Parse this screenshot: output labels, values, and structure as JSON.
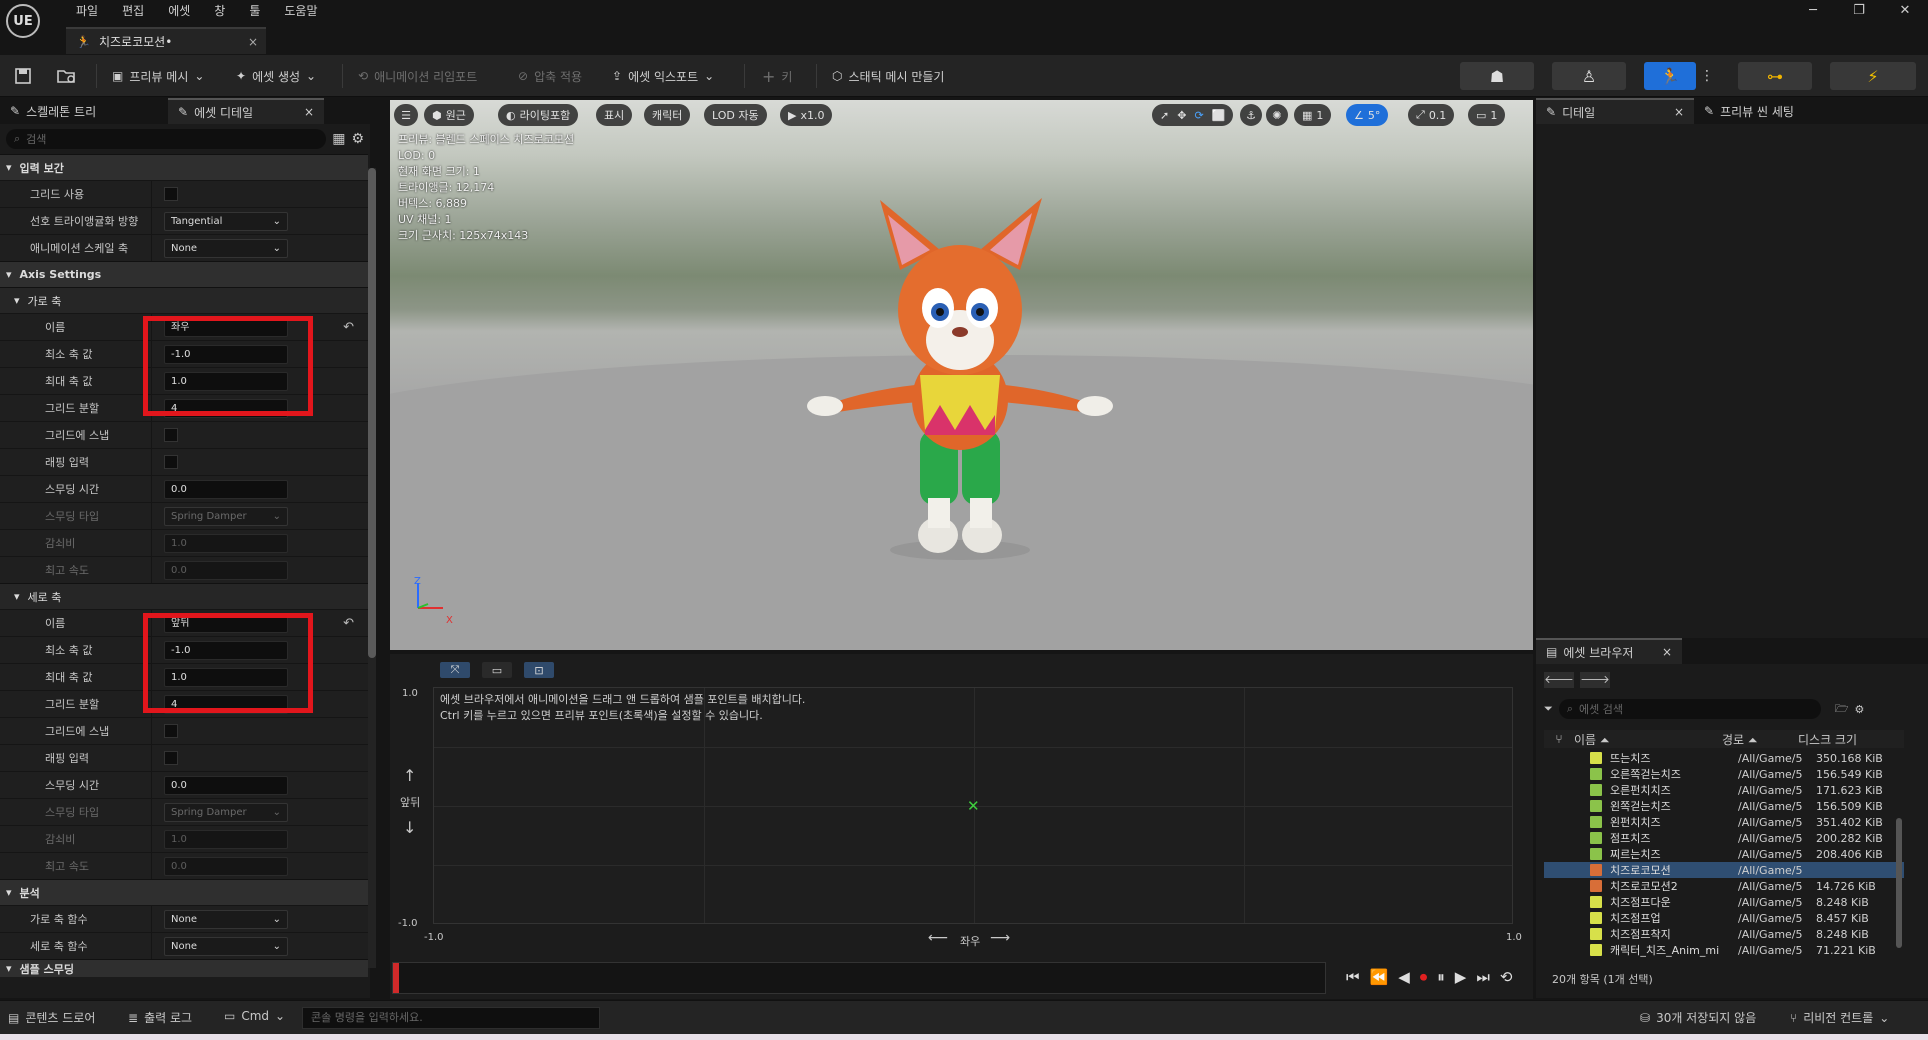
{
  "app": {
    "logo": "UE"
  },
  "menu": [
    "파일",
    "편집",
    "에셋",
    "창",
    "툴",
    "도움말"
  ],
  "doc_tab": {
    "title": "치즈로코모션•",
    "close": "×"
  },
  "window_controls": {
    "minimize": "─",
    "restore": "❐",
    "close": "✕"
  },
  "toolbar": {
    "preview_mesh": "프리뷰 메시",
    "asset_create": "에셋 생성",
    "anim_reimport": "애니메이션 리임포트",
    "apply_compression": "압축 적용",
    "asset_export": "에셋 익스포트",
    "key": "키",
    "make_static_mesh": "스태틱 메시 만들기"
  },
  "left_tabs": {
    "skeleton_tree": "스켈레톤 트리",
    "asset_details": "에셋 디테일",
    "close": "×"
  },
  "search": {
    "placeholder": "검색"
  },
  "sections": {
    "input_interp": "입력 보간",
    "axis_settings": "Axis Settings",
    "horizontal": "가로 축",
    "vertical": "세로 축",
    "analysis": "분석",
    "sample_smoothing": "샘플 스무딩"
  },
  "input_interp": {
    "use_grid": "그리드 사용",
    "pref_tri_dir": "선호 트라이앵귤화 방향",
    "pref_tri_dir_val": "Tangential",
    "anim_scale_axis": "애니메이션 스케일 축",
    "anim_scale_axis_val": "None"
  },
  "horizontal_axis": {
    "name_lbl": "이름",
    "name_val": "좌우",
    "min_lbl": "최소 축 값",
    "min_val": "-1.0",
    "max_lbl": "최대 축 값",
    "max_val": "1.0",
    "grid_div_lbl": "그리드 분할",
    "grid_div_val": "4",
    "snap_lbl": "그리드에 스냅",
    "wrap_lbl": "래핑 입력",
    "smooth_time_lbl": "스무딩 시간",
    "smooth_time_val": "0.0",
    "smooth_type_lbl": "스무딩 타입",
    "smooth_type_val": "Spring Damper",
    "damping_lbl": "감쇠비",
    "damping_val": "1.0",
    "max_speed_lbl": "최고 속도",
    "max_speed_val": "0.0"
  },
  "vertical_axis": {
    "name_lbl": "이름",
    "name_val": "앞뒤",
    "min_lbl": "최소 축 값",
    "min_val": "-1.0",
    "max_lbl": "최대 축 값",
    "max_val": "1.0",
    "grid_div_lbl": "그리드 분할",
    "grid_div_val": "4",
    "snap_lbl": "그리드에 스냅",
    "wrap_lbl": "래핑 입력",
    "smooth_time_lbl": "스무딩 시간",
    "smooth_time_val": "0.0",
    "smooth_type_lbl": "스무딩 타입",
    "smooth_type_val": "Spring Damper",
    "damping_lbl": "감쇠비",
    "damping_val": "1.0",
    "max_speed_lbl": "최고 속도",
    "max_speed_val": "0.0"
  },
  "analysis": {
    "h_func_lbl": "가로 축 함수",
    "h_func_val": "None",
    "v_func_lbl": "세로 축 함수",
    "v_func_val": "None"
  },
  "viewport": {
    "perspective": "원근",
    "lighting": "라이팅포함",
    "show": "표시",
    "character": "캐릭터",
    "lod": "LOD 자동",
    "speed": "x1.0",
    "grid_val": "1",
    "angle_val": "5°",
    "scale_val": "0.1",
    "cam_val": "1",
    "info": [
      "프리뷰: 블렌드 스페이스 치즈로코모션",
      "LOD: 0",
      "현재 화면 크기: 1",
      "트라이앵글: 12,174",
      "버텍스: 6,889",
      "UV 채널: 1",
      "크기 근사치: 125x74x143"
    ],
    "axis_z": "Z",
    "axis_x": "X"
  },
  "blendspace": {
    "hint1": "에셋 브라우저에서 애니메이션을 드래그 앤 드롭하여 샘플 포인트를 배치합니다.",
    "hint2": "Ctrl 키를 누르고 있으면 프리뷰 포인트(초록색)을 설정할 수 있습니다.",
    "y_max": "1.0",
    "y_min": "-1.0",
    "x_min": "-1.0",
    "x_max": "1.0",
    "y_axis": "앞뒤",
    "x_axis": "좌우"
  },
  "right_tabs": {
    "details": "디테일",
    "preview_scene": "프리뷰 씬 세팅",
    "close": "×"
  },
  "asset_browser": {
    "title": "에셋 브라우저",
    "close": "×",
    "search_placeholder": "에셋 검색",
    "col_name": "이름",
    "col_path": "경로",
    "col_size": "디스크 크기",
    "status": "20개 항목 (1개 선택)",
    "rows": [
      {
        "name": "뜨는치즈",
        "path": "/All/Game/5",
        "size": "350.168 KiB",
        "kind": "y"
      },
      {
        "name": "오른쪽걷는치즈",
        "path": "/All/Game/5",
        "size": "156.549 KiB",
        "kind": "g"
      },
      {
        "name": "오른펀치치즈",
        "path": "/All/Game/5",
        "size": "171.623 KiB",
        "kind": "g"
      },
      {
        "name": "왼쪽걷는치즈",
        "path": "/All/Game/5",
        "size": "156.509 KiB",
        "kind": "g"
      },
      {
        "name": "왼펀치치즈",
        "path": "/All/Game/5",
        "size": "351.402 KiB",
        "kind": "g"
      },
      {
        "name": "점프치즈",
        "path": "/All/Game/5",
        "size": "200.282 KiB",
        "kind": "g"
      },
      {
        "name": "찌르는치즈",
        "path": "/All/Game/5",
        "size": "208.406 KiB",
        "kind": "g"
      },
      {
        "name": "치즈로코모션",
        "path": "/All/Game/5",
        "size": "",
        "kind": "sel"
      },
      {
        "name": "치즈로코모션2",
        "path": "/All/Game/5",
        "size": "14.726 KiB",
        "kind": "o"
      },
      {
        "name": "치즈점프다운",
        "path": "/All/Game/5",
        "size": "8.248 KiB",
        "kind": "y"
      },
      {
        "name": "치즈점프업",
        "path": "/All/Game/5",
        "size": "8.457 KiB",
        "kind": "y"
      },
      {
        "name": "치즈점프착지",
        "path": "/All/Game/5",
        "size": "8.248 KiB",
        "kind": "y"
      },
      {
        "name": "캐릭터_치즈_Anim_mi",
        "path": "/All/Game/5",
        "size": "71.221 KiB",
        "kind": "y"
      }
    ]
  },
  "statusbar": {
    "content_drawer": "콘텐츠 드로어",
    "output_log": "출력 로그",
    "cmd": "Cmd",
    "console_placeholder": "콘솔 명령을 입력하세요.",
    "unsaved": "30개 저장되지 않음",
    "revision": "리비전 컨트롤"
  }
}
